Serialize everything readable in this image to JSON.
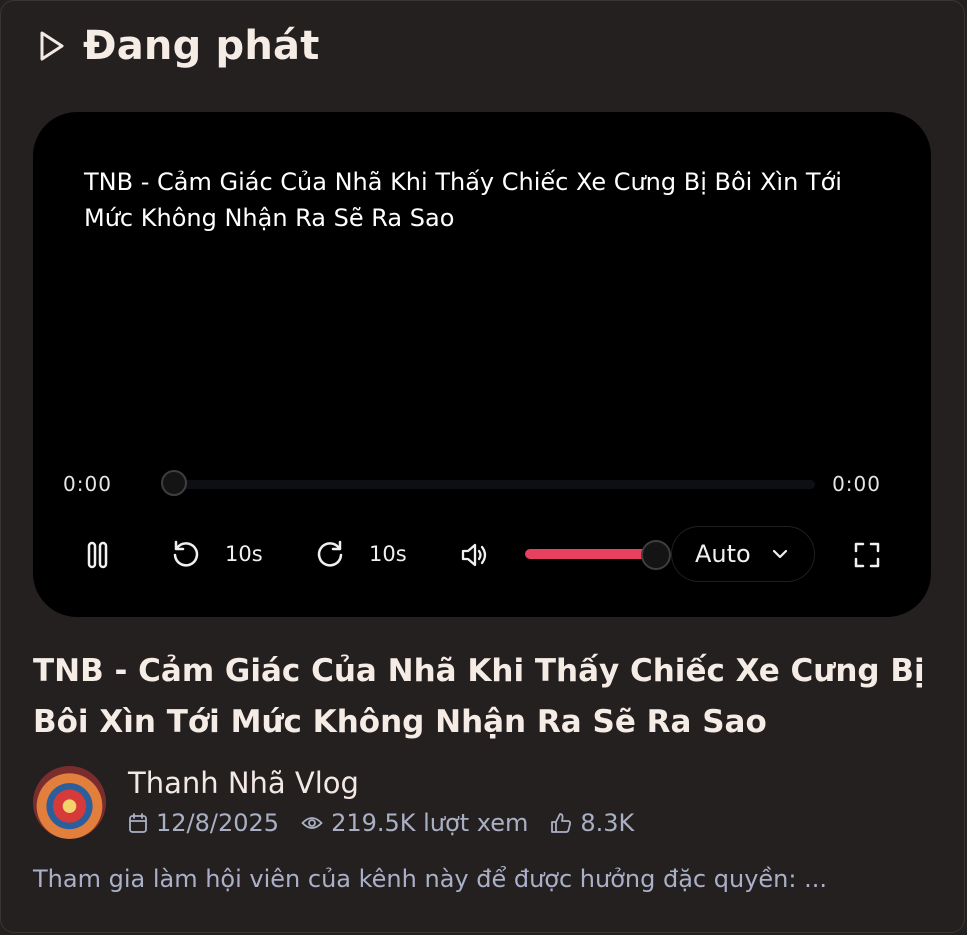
{
  "section": {
    "title": "Đang phát",
    "icon": "play-icon"
  },
  "player": {
    "overlay_title": "TNB - Cảm Giác Của Nhã Khi Thấy Chiếc Xe Cưng Bị Bôi Xìn Tới Mức Không Nhận Ra Sẽ Ra Sao",
    "current_time": "0:00",
    "duration": "0:00",
    "progress": 0,
    "rewind_label": "10s",
    "forward_label": "10s",
    "volume": 0.9,
    "quality": "Auto",
    "colors": {
      "accent": "#e8415f",
      "background": "#000000"
    }
  },
  "video": {
    "title": "TNB - Cảm Giác Của Nhã Khi Thấy Chiếc Xe Cưng Bị Bôi Xìn Tới Mức Không Nhận Ra Sẽ Ra Sao",
    "channel": "Thanh Nhã Vlog",
    "date": "12/8/2025",
    "views": "219.5K lượt xem",
    "likes": "8.3K",
    "description": "Tham gia làm hội viên của kênh này để được hưởng đặc quyền: ..."
  }
}
